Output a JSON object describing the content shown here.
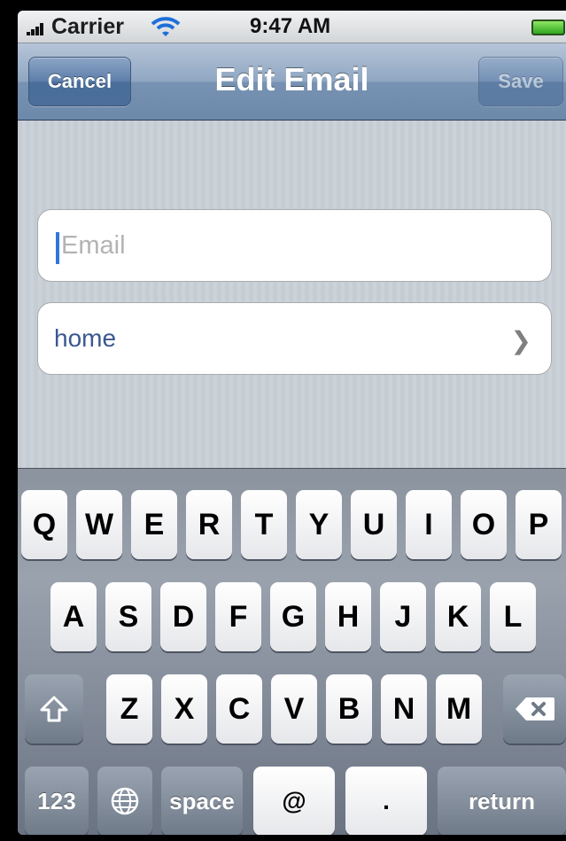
{
  "status_bar": {
    "carrier": "Carrier",
    "time": "9:47 AM",
    "wifi_icon": "wifi-icon",
    "battery_icon": "battery-icon"
  },
  "nav": {
    "title": "Edit Email",
    "cancel_label": "Cancel",
    "save_label": "Save",
    "save_enabled": false
  },
  "form": {
    "email": {
      "value": "",
      "placeholder": "Email"
    },
    "label_row": {
      "value": "home",
      "chevron_icon": "chevron-right-icon"
    }
  },
  "keyboard": {
    "row1": [
      "Q",
      "W",
      "E",
      "R",
      "T",
      "Y",
      "U",
      "I",
      "O",
      "P"
    ],
    "row2": [
      "A",
      "S",
      "D",
      "F",
      "G",
      "H",
      "J",
      "K",
      "L"
    ],
    "row3": [
      "Z",
      "X",
      "C",
      "V",
      "B",
      "N",
      "M"
    ],
    "shift_icon": "shift-icon",
    "delete_icon": "delete-icon",
    "numbers_label": "123",
    "globe_icon": "globe-icon",
    "space_label": "space",
    "at_label": "@",
    "dot_label": ".",
    "return_label": "return"
  },
  "colors": {
    "nav_bar": "#6d89aa",
    "label_text": "#3a5890",
    "cursor": "#2f78d4"
  }
}
